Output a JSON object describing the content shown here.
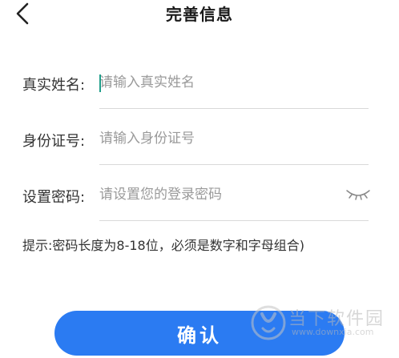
{
  "header": {
    "title": "完善信息",
    "back_icon": "chevron-left-icon"
  },
  "form": {
    "name": {
      "label": "真实姓名:",
      "placeholder": "请输入真实姓名",
      "value": ""
    },
    "id_number": {
      "label": "身份证号:",
      "placeholder": "请输入身份证号",
      "value": ""
    },
    "password": {
      "label": "设置密码:",
      "placeholder": "请设置您的登录密码",
      "value": "",
      "toggle_icon": "eye-closed-icon"
    }
  },
  "hint": "提示:密码长度为8-18位，必须是数字和字母组合)",
  "confirm_label": "确认",
  "watermark": {
    "name": "当下软件园",
    "url": "www.downxia.com"
  },
  "colors": {
    "primary": "#2b7bf2",
    "cursor": "#1f9e8a",
    "divider": "#d9d9d9",
    "placeholder": "#9a9a9a"
  }
}
